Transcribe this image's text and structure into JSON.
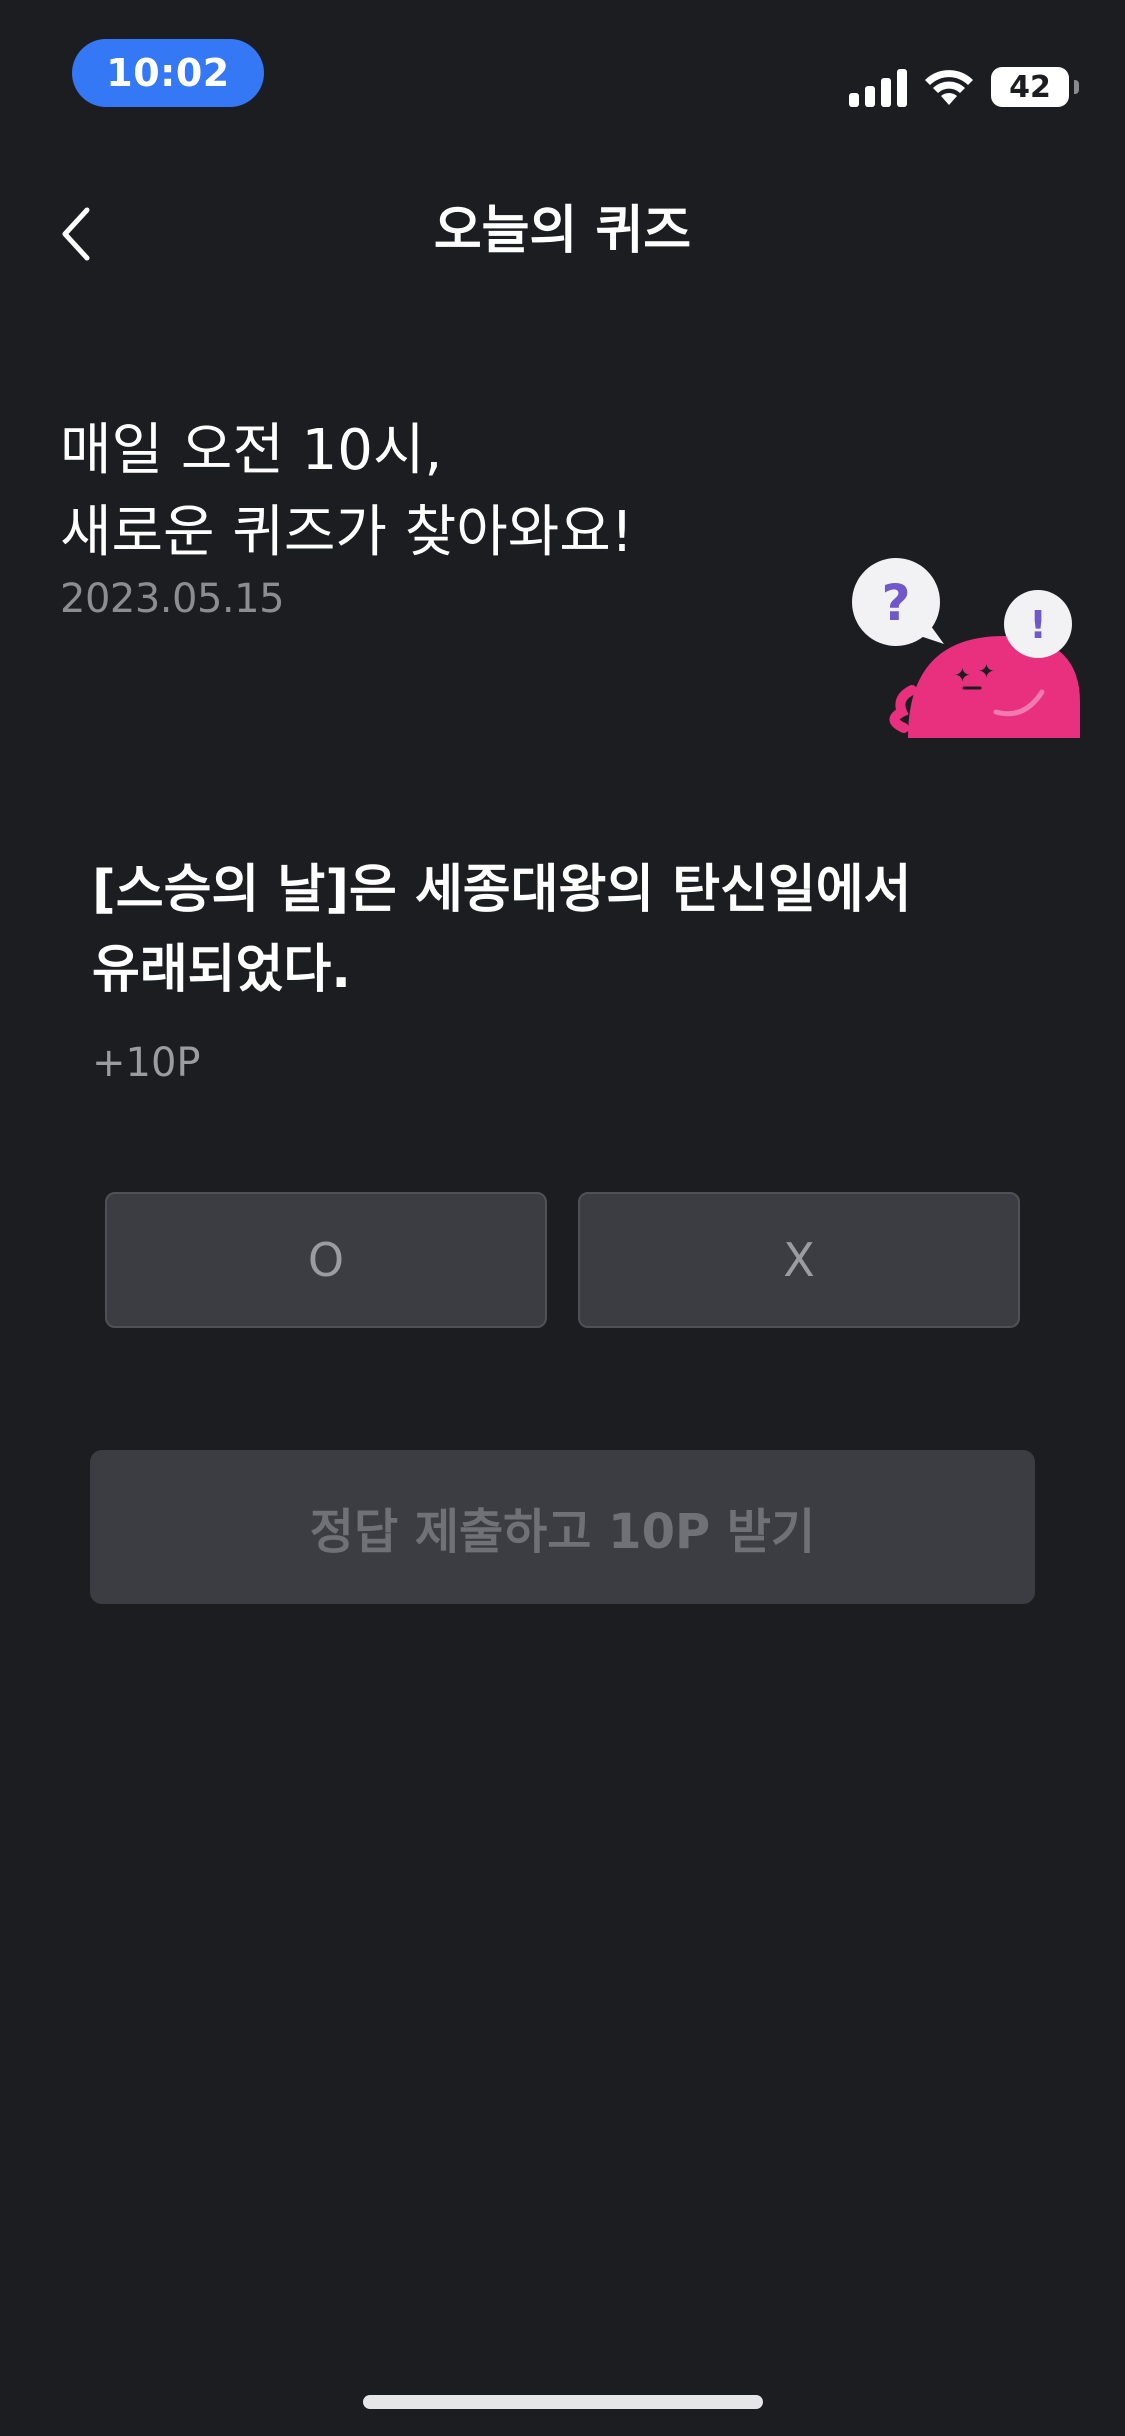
{
  "status_bar": {
    "time": "10:02",
    "battery": "42",
    "icons": [
      "signal-icon",
      "wifi-icon",
      "battery-icon"
    ]
  },
  "nav": {
    "back_icon": "chevron-left-icon",
    "title": "오늘의 퀴즈"
  },
  "intro": {
    "line1": "매일 오전 10시,",
    "line2": "새로운 퀴즈가 찾아와요!",
    "date": "2023.05.15"
  },
  "character": {
    "icon": "quiz-mascot-icon",
    "question_mark": "?",
    "exclamation_mark": "!",
    "colors": {
      "body": "#e8307f",
      "bubble": "#f2f2f4",
      "question_mark": "#6f58c9"
    }
  },
  "quiz": {
    "question": "[스승의 날]은 세종대왕의 탄신일에서 유래되었다.",
    "points": "+10P",
    "options": [
      "O",
      "X"
    ]
  },
  "submit": {
    "label": "정답 제출하고 10P 받기"
  },
  "colors": {
    "background": "#1c1d21",
    "time_pill": "#3478f6",
    "button_bg": "#3b3d42",
    "muted_text": "#8b8d93"
  }
}
